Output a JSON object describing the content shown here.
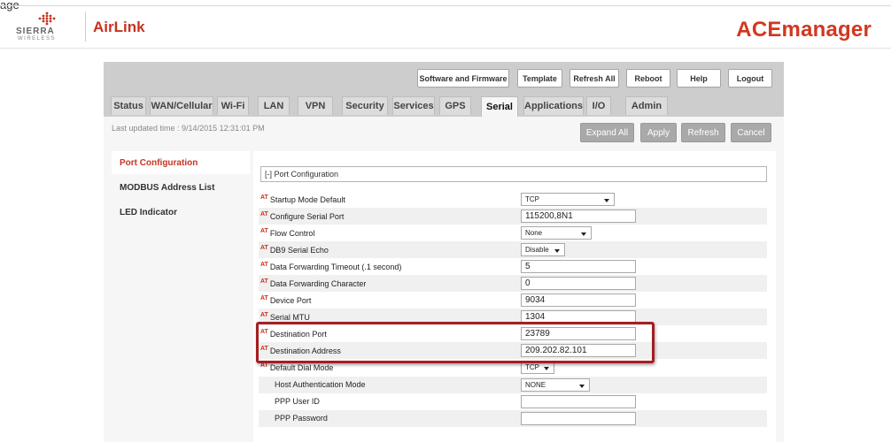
{
  "corner_text": "age",
  "brand": {
    "sierra": "SIERRA",
    "wireless": "WIRELESS",
    "airlink": "AirLink",
    "product": "ACEmanager"
  },
  "top_buttons": [
    {
      "id": "software",
      "label": "Software and Firmware"
    },
    {
      "id": "template",
      "label": "Template"
    },
    {
      "id": "refresh-all",
      "label": "Refresh All"
    },
    {
      "id": "reboot",
      "label": "Reboot"
    },
    {
      "id": "help",
      "label": "Help"
    },
    {
      "id": "logout",
      "label": "Logout"
    }
  ],
  "tabs": [
    "Status",
    "WAN/Cellular",
    "Wi-Fi",
    "LAN",
    "VPN",
    "Security",
    "Services",
    "GPS",
    "Serial",
    "Applications",
    "I/O",
    "Admin"
  ],
  "active_tab": "Serial",
  "last_updated": "Last updated time : 9/14/2015 12:31:01 PM",
  "action_buttons": {
    "expand_all": "Expand All",
    "apply": "Apply",
    "refresh": "Refresh",
    "cancel": "Cancel"
  },
  "left_nav": [
    "Port Configuration",
    "MODBUS Address List",
    "LED Indicator"
  ],
  "active_nav": "Port Configuration",
  "section_title": "[-] Port Configuration",
  "at_prefix": "AT",
  "fields": [
    {
      "label": "Startup Mode Default",
      "type": "select",
      "value": "TCP",
      "at": true
    },
    {
      "label": "Configure Serial Port",
      "type": "text",
      "value": "115200,8N1",
      "at": true
    },
    {
      "label": "Flow Control",
      "type": "select",
      "value": "None",
      "at": true
    },
    {
      "label": "DB9 Serial Echo",
      "type": "select",
      "value": "Disable",
      "at": true
    },
    {
      "label": "Data Forwarding Timeout (.1 second)",
      "type": "text",
      "value": "5",
      "at": true
    },
    {
      "label": "Data Forwarding Character",
      "type": "text",
      "value": "0",
      "at": true
    },
    {
      "label": "Device Port",
      "type": "text",
      "value": "9034",
      "at": true
    },
    {
      "label": "Serial MTU",
      "type": "text",
      "value": "1304",
      "at": true
    },
    {
      "label": "Destination Port",
      "type": "text",
      "value": "23789",
      "at": true
    },
    {
      "label": "Destination Address",
      "type": "text",
      "value": "209.202.82.101",
      "at": true
    },
    {
      "label": "Default Dial Mode",
      "type": "select",
      "value": "TCP",
      "at": true
    },
    {
      "label": "Host Authentication Mode",
      "type": "select",
      "value": "NONE",
      "at": false
    },
    {
      "label": "PPP User ID",
      "type": "text",
      "value": "",
      "at": false
    },
    {
      "label": "PPP Password",
      "type": "text",
      "value": "",
      "at": false
    }
  ],
  "colors": {
    "brand_red": "#d2371f",
    "highlight": "#a51e22",
    "panel_grey": "#cdcdcd"
  }
}
